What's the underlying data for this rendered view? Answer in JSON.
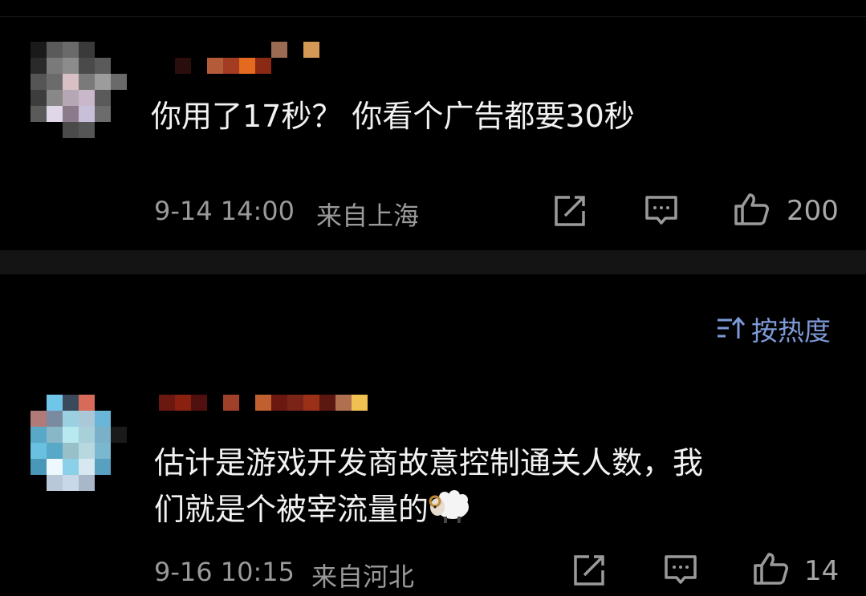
{
  "comments": [
    {
      "text": "你用了17秒？ 你看个广告都要30秒",
      "date": "9-14 14:00",
      "location": "来自上海",
      "likes": "200"
    },
    {
      "text_line1": "估计是游戏开发商故意控制通关人数，我",
      "text_line2": "们就是个被宰流量的",
      "emoji": "sheep-emoji",
      "date": "9-16 10:15",
      "location": "来自河北",
      "likes": "14"
    }
  ],
  "sort": {
    "label": "按热度"
  },
  "icons": {
    "share": "share-icon",
    "reply": "comment-icon",
    "like": "thumbs-up-icon",
    "sort": "sort-icon"
  },
  "colors": {
    "background": "#000000",
    "text": "#f2f2f2",
    "meta": "#9a9a9a",
    "accent": "#7d99d6"
  }
}
